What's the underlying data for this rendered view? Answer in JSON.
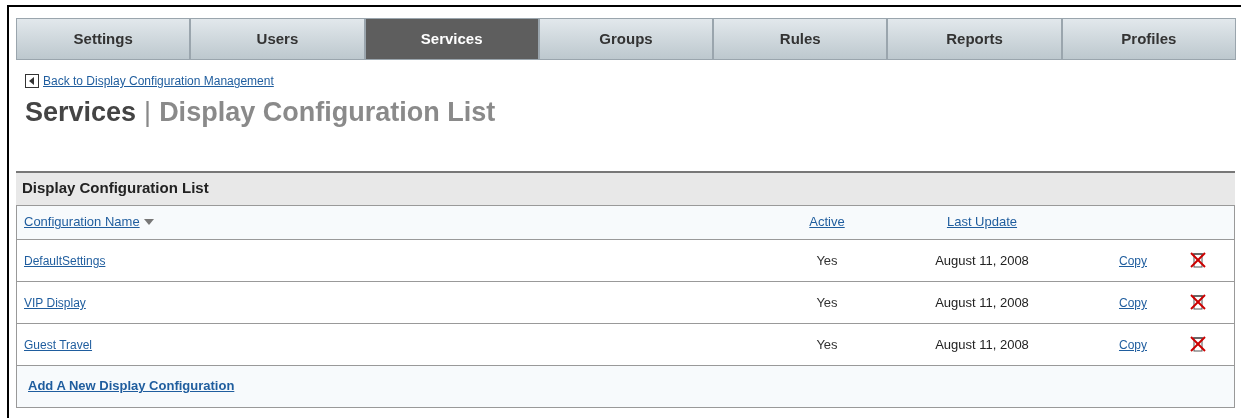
{
  "tabs": [
    {
      "label": "Settings",
      "selected": false
    },
    {
      "label": "Users",
      "selected": false
    },
    {
      "label": "Services",
      "selected": true
    },
    {
      "label": "Groups",
      "selected": false
    },
    {
      "label": "Rules",
      "selected": false
    },
    {
      "label": "Reports",
      "selected": false
    },
    {
      "label": "Profiles",
      "selected": false
    }
  ],
  "back_link": "Back to Display Configuration Management",
  "page_title": {
    "section": "Services",
    "separator": "|",
    "page": "Display Configuration List"
  },
  "list": {
    "title": "Display Configuration List",
    "columns": [
      {
        "label": "Configuration Name",
        "sorted": true
      },
      {
        "label": "Active",
        "sorted": false
      },
      {
        "label": "Last Update",
        "sorted": false
      }
    ],
    "rows": [
      {
        "name": "DefaultSettings",
        "active": "Yes",
        "last_update": "August 11, 2008",
        "action": "Copy"
      },
      {
        "name": "VIP Display",
        "active": "Yes",
        "last_update": "August 11, 2008",
        "action": "Copy"
      },
      {
        "name": "Guest Travel",
        "active": "Yes",
        "last_update": "August 11, 2008",
        "action": "Copy"
      }
    ],
    "add_link": "Add A New Display Configuration"
  }
}
